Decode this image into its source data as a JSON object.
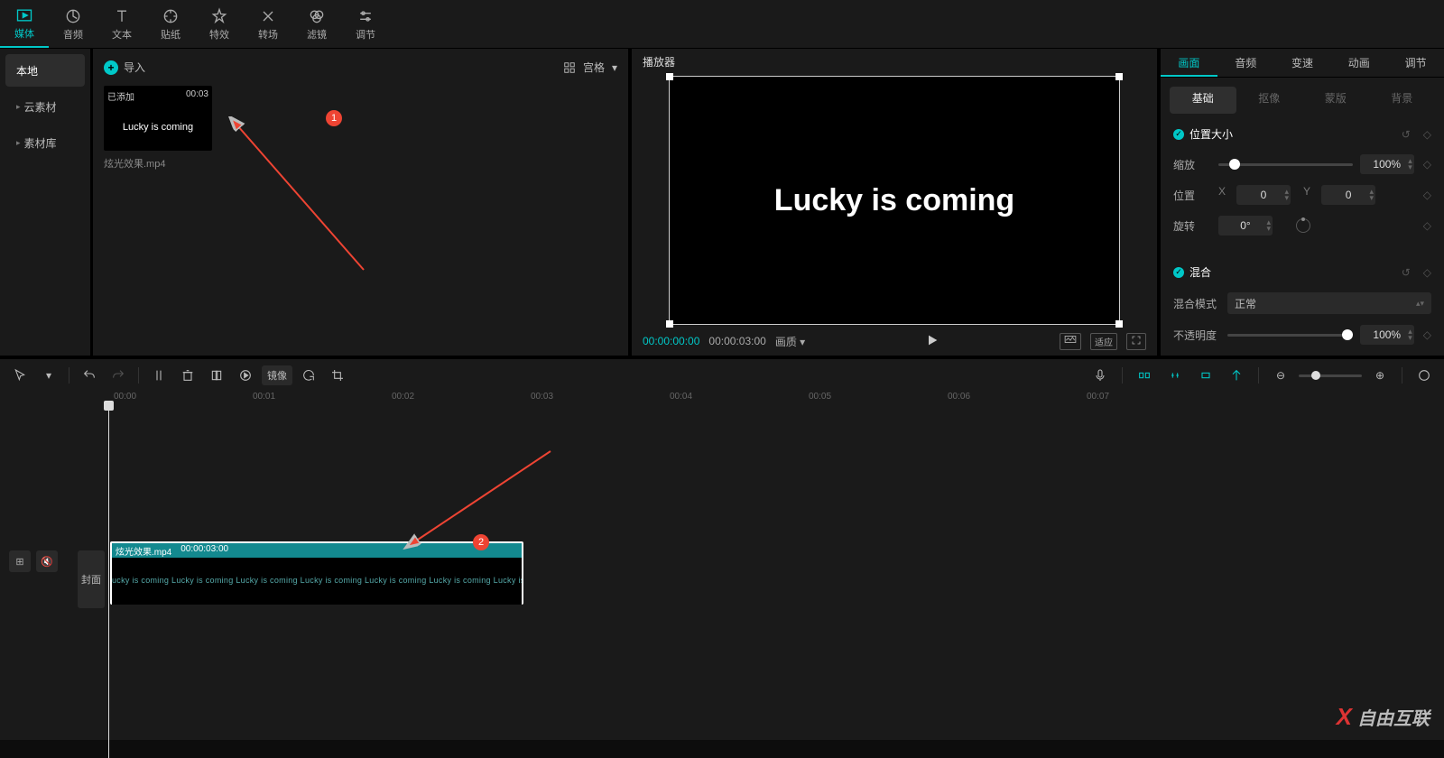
{
  "topTabs": [
    {
      "label": "媒体",
      "icon": "media"
    },
    {
      "label": "音频",
      "icon": "audio"
    },
    {
      "label": "文本",
      "icon": "text"
    },
    {
      "label": "贴纸",
      "icon": "sticker"
    },
    {
      "label": "特效",
      "icon": "effect"
    },
    {
      "label": "转场",
      "icon": "transition"
    },
    {
      "label": "滤镜",
      "icon": "filter"
    },
    {
      "label": "调节",
      "icon": "adjust"
    }
  ],
  "leftNav": {
    "items": [
      {
        "label": "本地",
        "active": true
      },
      {
        "label": "云素材",
        "expandable": true
      },
      {
        "label": "素材库",
        "expandable": true
      }
    ]
  },
  "media": {
    "importLabel": "导入",
    "viewLabel": "宫格",
    "clip": {
      "badge": "已添加",
      "duration": "00:03",
      "previewText": "Lucky is coming",
      "filename": "炫光效果.mp4"
    }
  },
  "player": {
    "title": "播放器",
    "text": "Lucky is coming",
    "currentTime": "00:00:00:00",
    "totalTime": "00:00:03:00",
    "quality": "画质",
    "ratioBtn": "适应"
  },
  "props": {
    "tabs": [
      "画面",
      "音频",
      "变速",
      "动画",
      "调节"
    ],
    "subtabs": [
      "基础",
      "抠像",
      "蒙版",
      "背景"
    ],
    "posSize": {
      "title": "位置大小",
      "scale": {
        "label": "缩放",
        "value": "100%"
      },
      "position": {
        "label": "位置",
        "xLabel": "X",
        "x": "0",
        "yLabel": "Y",
        "y": "0"
      },
      "rotation": {
        "label": "旋转",
        "value": "0°"
      }
    },
    "blend": {
      "title": "混合",
      "modeLabel": "混合模式",
      "modeValue": "正常",
      "opacityLabel": "不透明度",
      "opacityValue": "100%"
    }
  },
  "timelineToolbar": {
    "mirror": "镜像"
  },
  "ruler": [
    "00:00",
    "00:01",
    "00:02",
    "00:03",
    "00:04",
    "00:05",
    "00:06",
    "00:07"
  ],
  "track": {
    "cover": "封面",
    "clipName": "炫光效果.mp4",
    "clipDur": "00:00:03:00",
    "bodyText": "ucky is coming  Lucky is coming  Lucky is coming  Lucky is coming  Lucky is coming  Lucky is coming  Lucky is coming  Lu"
  },
  "annotations": {
    "n1": "1",
    "n2": "2"
  },
  "watermark": "自由互联"
}
